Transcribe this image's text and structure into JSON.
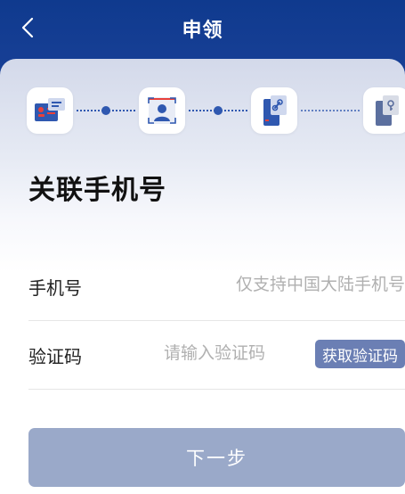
{
  "header": {
    "title": "申领",
    "back_icon": "chevron-left-icon"
  },
  "steps": [
    {
      "icon": "id-card-icon",
      "state": "current"
    },
    {
      "icon": "face-scan-icon",
      "state": "pending"
    },
    {
      "icon": "phone-link-icon",
      "state": "pending"
    },
    {
      "icon": "phone-key-icon",
      "state": "pending"
    }
  ],
  "page": {
    "heading": "关联手机号"
  },
  "form": {
    "phone": {
      "label": "手机号",
      "value": "",
      "placeholder": "仅支持中国大陆手机号"
    },
    "code": {
      "label": "验证码",
      "value": "",
      "placeholder": "请输入验证码",
      "button_label": "获取验证码"
    }
  },
  "actions": {
    "next_label": "下一步"
  },
  "colors": {
    "header_bg": "#173f95",
    "accent": "#2f58b0",
    "code_button_bg": "#6b7fb4",
    "next_button_disabled_bg": "#9aa9c9"
  }
}
